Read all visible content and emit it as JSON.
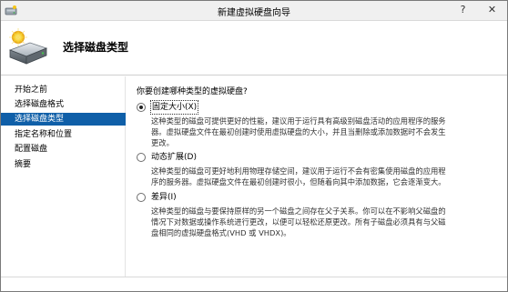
{
  "window": {
    "title": "新建虚拟硬盘向导",
    "help_label": "?",
    "close_label": "✕"
  },
  "header": {
    "title": "选择磁盘类型",
    "icon": "virtual-disk-icon"
  },
  "steps": [
    {
      "label": "开始之前",
      "active": false
    },
    {
      "label": "选择磁盘格式",
      "active": false
    },
    {
      "label": "选择磁盘类型",
      "active": true
    },
    {
      "label": "指定名称和位置",
      "active": false
    },
    {
      "label": "配置磁盘",
      "active": false
    },
    {
      "label": "摘要",
      "active": false
    }
  ],
  "main": {
    "question": "你要创建哪种类型的虚拟硬盘?",
    "options": [
      {
        "label": "固定大小(X)",
        "checked": true,
        "desc_lines": [
          "这种类型的磁盘可提供更好的性能，建议用于运行具有高级别磁盘活动的应用程序的服务",
          "器。虚拟硬盘文件在最初创建时使用虚拟硬盘的大小，并且当删除或添加数据时不会发生",
          "更改。"
        ]
      },
      {
        "label": "动态扩展(D)",
        "checked": false,
        "desc_lines": [
          "这种类型的磁盘可更好地利用物理存储空间，建议用于运行不会有密集使用磁盘的应用程",
          "序的服务器。虚拟硬盘文件在最初创建时很小，但随着向其中添加数据，它会逐渐变大。"
        ]
      },
      {
        "label": "差异(I)",
        "checked": false,
        "desc_lines": [
          "这种类型的磁盘与要保持原样的另一个磁盘之间存在父子关系。你可以在不影响父磁盘的",
          "情况下对数据或操作系统进行更改，以便可以轻松还原更改。所有子磁盘必须具有与父磁",
          "盘相同的虚拟硬盘格式(VHD 或 VHDX)。"
        ]
      }
    ]
  }
}
